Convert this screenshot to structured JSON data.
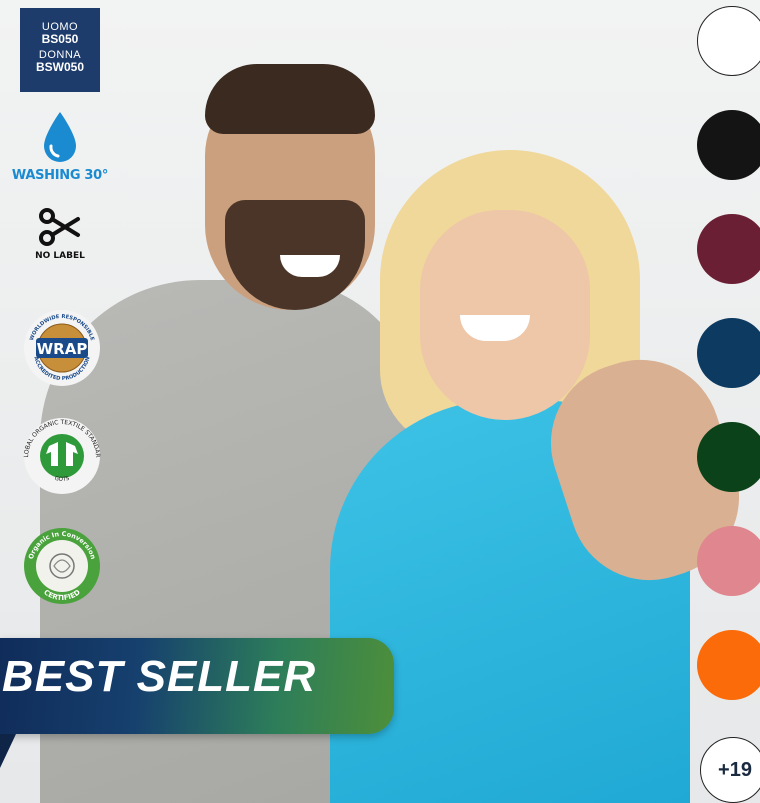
{
  "product_codes": {
    "men_label": "UOMO",
    "men_code": "BS050",
    "women_label": "DONNA",
    "women_code": "BSW050"
  },
  "care_icons": {
    "washing_icon": "water-drop-icon",
    "washing_text": "WASHING 30°",
    "label_icon": "scissors-icon",
    "label_text": "NO LABEL"
  },
  "certifications": {
    "wrap": {
      "icon": "wrap-badge-icon",
      "mark_text": "WRAP",
      "ring_top": "WORLDWIDE RESPONSIBLE",
      "ring_bottom": "ACCREDITED PRODUCTION"
    },
    "gots": {
      "icon": "gots-badge-icon",
      "ring_top": "GLOBAL ORGANIC TEXTILE STANDARD",
      "ring_bottom": "GOTS"
    },
    "organic": {
      "icon": "organic-cotton-badge-icon",
      "ring_top": "Organic In Conversion",
      "ring_bottom": "CERTIFIED"
    }
  },
  "colors": {
    "swatches": [
      {
        "name": "white",
        "hex": "#ffffff"
      },
      {
        "name": "black",
        "hex": "#141414"
      },
      {
        "name": "burgundy",
        "hex": "#6b1f34"
      },
      {
        "name": "navy",
        "hex": "#0c3a60"
      },
      {
        "name": "bottle-green",
        "hex": "#0b4219"
      },
      {
        "name": "pink",
        "hex": "#e0868e"
      },
      {
        "name": "orange",
        "hex": "#fb6b0a"
      }
    ],
    "more_label": "+19"
  },
  "badge": {
    "text": "BEST SELLER"
  },
  "photo": {
    "icon": "product-photo"
  }
}
